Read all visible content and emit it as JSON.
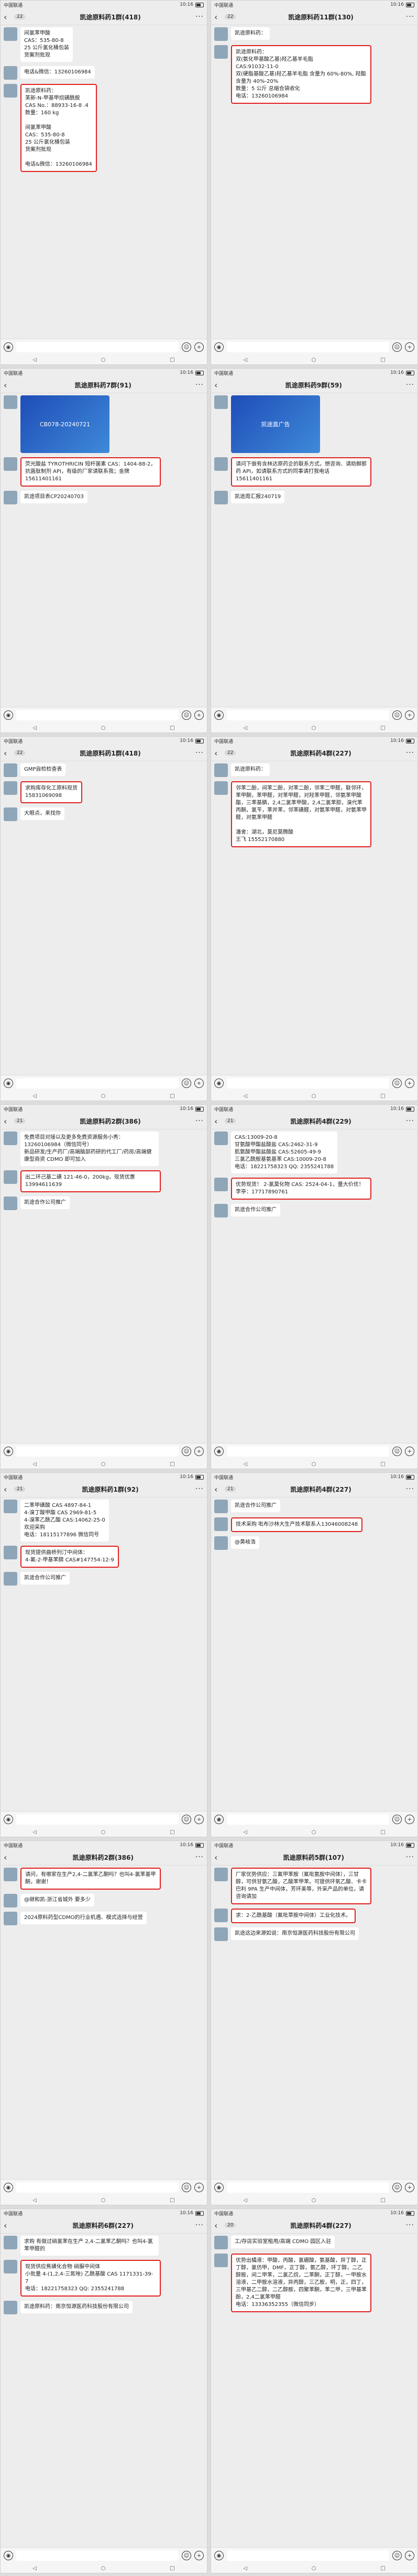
{
  "status": {
    "carrier": "中国联通",
    "time": "10:16"
  },
  "input_icons": {
    "voice": "voice-icon",
    "emoji": "emoji-icon",
    "plus": "plus-icon"
  },
  "panels": [
    {
      "back_count": "22",
      "title": "凯途原料药1群(418)",
      "messages": [
        {
          "sender": "",
          "text": "间氯苯甲酸\nCAS：535-80-8\n25 公斤氯化桶包装\n货案剂批现",
          "highlight": false
        },
        {
          "sender": "",
          "text": "电话&微信：13260106984",
          "highlight": false
        },
        {
          "sender": "",
          "text": "凯途原料药：\n芙新-N-甲基甲烷磺酰胺\nCAS No.：88933-16-8 .4\n数量：160 kg\n\n间氯苯甲酸\nCAS：535-80-8\n25 公斤氯化桶包装\n货案剂批现\n\n电话&微信：13260106984",
          "highlight": true
        }
      ]
    },
    {
      "back_count": "22",
      "title": "凯途原料药11群(130)",
      "messages": [
        {
          "sender": "",
          "text": "凯途原料药：",
          "highlight": false
        },
        {
          "sender": "",
          "text": "凯途原料药：\n双(氨化甲基酸乙基)羟乙基羊毛脂\nCAS:91032-11-0\n双(硬脂基酸乙基)羟乙基羊毛脂 含量为 60%-80%, 羟酯含量为 40%-20%\n数量：5 公斤 总缩合袋收化\n电话：13260106984",
          "highlight": true
        }
      ]
    },
    {
      "back_count": "",
      "title": "凯途原料药7群(91)",
      "messages": [
        {
          "sender": "",
          "text": "CB078-20240721",
          "highlight": false,
          "image": true
        },
        {
          "sender": "",
          "text": "荧光酸盐 TYROTHRICIN 短杆菌素 CAS：1404-88-2，抗菌肽制剂 API，有级的厂家请联系我；金牌\n15611401161",
          "highlight": true
        },
        {
          "sender": "",
          "text": "凯途项目表CP20240703",
          "highlight": false
        }
      ]
    },
    {
      "back_count": "",
      "title": "凯途原料药9群(59)",
      "messages": [
        {
          "sender": "",
          "text": "凯途直广告",
          "highlight": false,
          "image": true
        },
        {
          "sender": "",
          "text": "请问下做有含林达原药企的联系方式，想咨询、请助脚那药 API，如请联系方式的同事请打我电话\n15611401161",
          "highlight": true
        },
        {
          "sender": "",
          "text": "凯途周汇报240719",
          "highlight": false
        }
      ]
    },
    {
      "back_count": "22",
      "title": "凯途原料药1群(418)",
      "messages": [
        {
          "sender": "",
          "text": "GMP自检检查表",
          "highlight": false
        },
        {
          "sender": "",
          "text": "求购库存化工原料现货\n15831069098",
          "highlight": true
        },
        {
          "sender": "",
          "text": "大眼点，来找你",
          "highlight": false
        }
      ]
    },
    {
      "back_count": "22",
      "title": "凯途原料药4群(227)",
      "messages": [
        {
          "sender": "",
          "text": "凯途原料药：",
          "highlight": false
        },
        {
          "sender": "",
          "text": "邻苯二酚，间苯二酚，对苯二酚，邻苯二甲醛，联邻环，苯甲酮，苯甲醛，对苯甲醛，对羟苯甲醛，邻氨苯甲酸酯，三苯基膦，2,4二氯苯甲酸，2,4二氯苯腙，溴代苯丙酮，氯苄，苯并苯，邻苯磺醛，对氨苯甲醛，对氨苯甲醛，对氨苯甲醛\n\n潘舍：湖北，莫尼莫腾酸\n王飞 15552170880",
          "highlight": true
        }
      ]
    },
    {
      "back_count": "21",
      "title": "凯途原料药2群(386)",
      "messages": [
        {
          "sender": "",
          "text": "免费项目对接以及更多免费资源服务小秀：13260106984（微信同号）\n新品研发/生产药厂/高端脑部药研的代工厂/药房/高端健康型商资 CDMO 即可加入",
          "highlight": false
        },
        {
          "sender": "",
          "text": "出二环己基二磺 121-46-0，200kg，现货优惠13994611639",
          "highlight": true
        },
        {
          "sender": "",
          "text": "凯途合作公司推广",
          "highlight": false
        }
      ]
    },
    {
      "back_count": "21",
      "title": "凯途原料药4群(229)",
      "messages": [
        {
          "sender": "",
          "text": "CAS:13009-20-8\n甘氨酸甲酯盐酸盐 CAS:2462-31-9\n肌氨酸甲酯盐酸盐 CAS:52605-49-9\n三氯乙酰胺基氨基苯 CAS:10009-20-8\n电话：18221758323 QQ: 2355241788",
          "highlight": false
        },
        {
          "sender": "",
          "text": "优势现货！ 2-氯莫化物 CAS: 2524-04-1，量大价优！李亭：17717890761",
          "highlight": true
        },
        {
          "sender": "",
          "text": "凯途合作公司推广",
          "highlight": false
        }
      ]
    },
    {
      "back_count": "21",
      "title": "凯途原料药1群(92)",
      "messages": [
        {
          "sender": "",
          "text": "二苯甲磺酸 CAS 4897-84-1\n4-溴丁酸甲酯 CAS 2969-81-5\n4-溴苯乙酰乙酯 CAS:14062-25-0\n欢迎采购\n电话：18115177896 微信同号",
          "highlight": false
        },
        {
          "sender": "",
          "text": "现货提供曲桥列汀中间体：\n4-氟-2-甲基苯腈 CAS#147754-12-9",
          "highlight": true
        },
        {
          "sender": "",
          "text": "凯途合作公司推广",
          "highlight": false
        }
      ]
    },
    {
      "back_count": "21",
      "title": "凯途原料药4群(227)",
      "messages": [
        {
          "sender": "",
          "text": "凯途合作公司推广",
          "highlight": false
        },
        {
          "sender": "",
          "text": "技术采购 吡布沙林大生产技术联系人13046008248",
          "highlight": true
        },
        {
          "sender": "",
          "text": "@黄岐浩",
          "highlight": false
        }
      ]
    },
    {
      "back_count": "",
      "title": "凯途原料药2群(386)",
      "messages": [
        {
          "sender": "",
          "text": "请问，有哪家在生产2,4-二氯苯乙酮吗？也叫4-氯苯基甲酮，谢谢！",
          "highlight": true
        },
        {
          "sender": "",
          "text": "@继和凯-浙江省城外 要多少",
          "highlight": false
        },
        {
          "sender": "",
          "text": "2024原料药型CDMO的行业机遇、模式选择与经营",
          "highlight": false
        }
      ]
    },
    {
      "back_count": "",
      "title": "凯途原料药5群(107)",
      "messages": [
        {
          "sender": "",
          "text": "厂家优势供应：三氟甲苯胺（氟吡氨胺中间体），三甘醇，可供甘氨乙酸，乙酸苯甲苯。可提供环氧乙酸、卡卡巴利 9PA 生产中间体，芳环美等，外采产品的单位，请咨询请加",
          "highlight": true
        },
        {
          "sender": "",
          "text": "求：2-乙酰基酸（氟吡草胺中间体）工业化技术。",
          "highlight": true
        },
        {
          "sender": "",
          "text": "凯途这边来源如说：南京恒源医药科技股份有限公司",
          "highlight": false
        }
      ]
    },
    {
      "back_count": "",
      "title": "凯途原料药6群(227)",
      "messages": [
        {
          "sender": "",
          "text": "求购 有做过硝氯苯在生产 2,4-二氯苯乙酮吗？也叫4-氯苯甲醛的",
          "highlight": false
        },
        {
          "sender": "",
          "text": "现货供应焦磺化合物 硝脲中间体\n小批量 4-(1,2,4-三氮唑) 乙酰基酸 CAS 1171331-39-7\n电话：18221758323 QQ: 2355241788",
          "highlight": true
        },
        {
          "sender": "",
          "text": "凯途原料药：南京恒源医药科技股份有限公司",
          "highlight": false
        }
      ]
    },
    {
      "back_count": "20",
      "title": "凯途原料药4群(227)",
      "messages": [
        {
          "sender": "",
          "text": "工/存店实验室租用/高端 CDMO 园区入驻",
          "highlight": false
        },
        {
          "sender": "",
          "text": "优势出橘液：甲酸，丙酸，氯硼酸，氨基酸，异丁醇，正丁醇，氯仿甲，DMF，正丁醇，氨乙醇，环丁醇，二乙醇胺，间二甲苯，二氯乙烷，二苯酮，正丁醇，一甲胺水溶液，二甲胺水溶液，异丙醇，三乙胺，明，正，四丁，三甲基乙二醇，二乙醇胺，四聚苯酮，苯二甲，三甲基苯酚，2,4二氯苯甲醛\n电话：13336352355（微信同步）",
          "highlight": true
        }
      ]
    }
  ]
}
